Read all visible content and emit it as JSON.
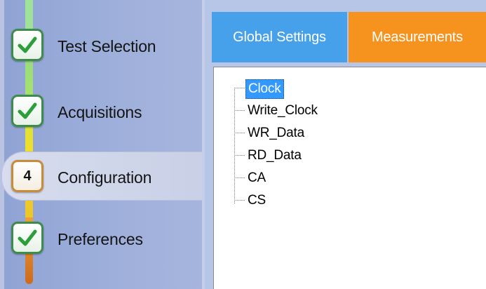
{
  "wizard": {
    "steps": [
      {
        "label": "Test Selection",
        "state": "complete"
      },
      {
        "label": "Acquisitions",
        "state": "complete"
      },
      {
        "label": "Configuration",
        "state": "current",
        "number": "4"
      },
      {
        "label": "Preferences",
        "state": "complete"
      }
    ]
  },
  "tabs": [
    {
      "label": "Global Settings",
      "color": "#47a0ea"
    },
    {
      "label": "Measurements",
      "color": "#f6921e",
      "selected": true
    }
  ],
  "tree": {
    "items": [
      "Clock",
      "Write_Clock",
      "WR_Data",
      "RD_Data",
      "CA",
      "CS"
    ],
    "selected": "Clock"
  },
  "colors": {
    "complete_check": "#2c9e3a",
    "selection": "#3399ff"
  }
}
